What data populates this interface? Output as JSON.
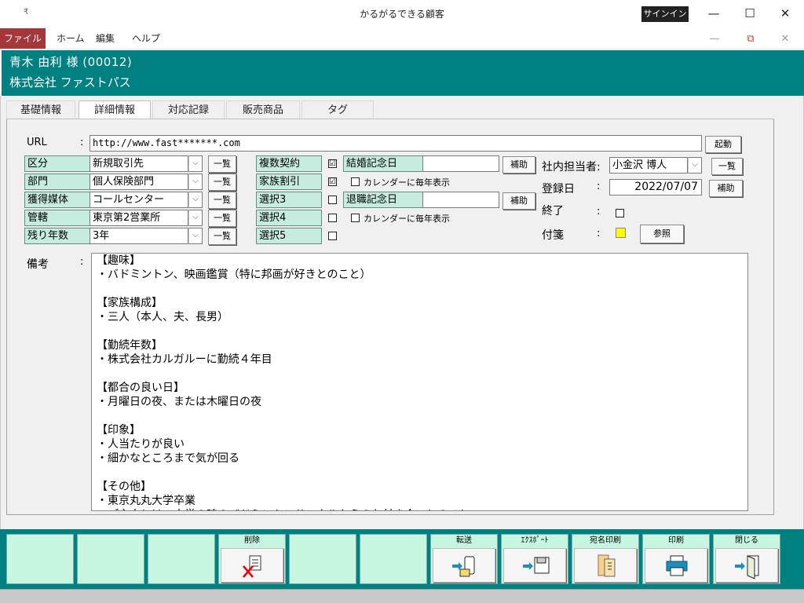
{
  "window": {
    "title": "かるがるできる顧客",
    "signin": "サインイン",
    "qat": "₹",
    "minimize": "—",
    "maximize": "☐",
    "close": "✕"
  },
  "menu": {
    "file": "ファイル",
    "home": "ホーム",
    "edit": "編集",
    "help": "ヘルプ",
    "mdi_min": "—",
    "mdi_restore": "⧉",
    "mdi_close": "✕"
  },
  "header": {
    "name": "青木 由利 様 (00012)",
    "company": "株式会社 ファストパス"
  },
  "tabs": [
    "基礎情報",
    "詳細情報",
    "対応記録",
    "販売商品",
    "タグ"
  ],
  "url": {
    "label": "URL",
    "colon": ":",
    "value": "http://www.fast*******.com",
    "launch": "起動"
  },
  "rows": [
    {
      "label": "区分",
      "value": "新規取引先",
      "button": "一覧"
    },
    {
      "label": "部門",
      "value": "個人保険部門",
      "button": "一覧"
    },
    {
      "label": "獲得媒体",
      "value": "コールセンター",
      "button": "一覧"
    },
    {
      "label": "管轄",
      "value": "東京第2営業所",
      "button": "一覧"
    },
    {
      "label": "残り年数",
      "value": "3年",
      "button": "一覧"
    }
  ],
  "flags": [
    {
      "label": "複数契約",
      "checked": "☑"
    },
    {
      "label": "家族割引",
      "checked": "☑"
    },
    {
      "label": "選択3",
      "checked": ""
    },
    {
      "label": "選択4",
      "checked": ""
    },
    {
      "label": "選択5",
      "checked": ""
    }
  ],
  "anniversary": {
    "wedding_label": "結婚記念日",
    "retire_label": "退職記念日",
    "assist": "補助",
    "calendar_label": "カレンダーに毎年表示"
  },
  "right": {
    "staff_label": "社内担当者:",
    "staff_value": "小金沢 博人",
    "list": "一覧",
    "reg_label": "登録日",
    "reg_colon": ":",
    "reg_value": "2022/07/07",
    "assist": "補助",
    "end_label": "終了",
    "end_colon": ":",
    "sticky_label": "付箋",
    "sticky_colon": ":",
    "sticky_color": "#ffff00",
    "ref": "参照"
  },
  "memo": {
    "label": "備考",
    "colon": ":",
    "text": "【趣味】\n・バドミントン、映画鑑賞（特に邦画が好きとのこと）\n\n【家族構成】\n・三人（本人、夫、長男）\n\n【勤続年数】\n・株式会社カルガルーに勤続４年目\n\n【都合の良い日】\n・月曜日の夜、または木曜日の夜\n\n【印象】\n・人当たりが良い\n・細かなところまで気が回る\n\n【その他】\n・東京丸丸大学卒業\n・ご主人とは、大学の時のバドミントンサークルからのお付き合いとのこと"
  },
  "footer": {
    "delete": "削除",
    "forward": "転送",
    "export": "ｴｸｽﾎﾟｰﾄ",
    "address_print": "宛名印刷",
    "print": "印刷",
    "close": "閉じる"
  },
  "colors": {
    "teal": "#008080",
    "cell": "#c6ece0",
    "footer_btn": "#c6f5e0",
    "file_menu": "#a4373a"
  }
}
